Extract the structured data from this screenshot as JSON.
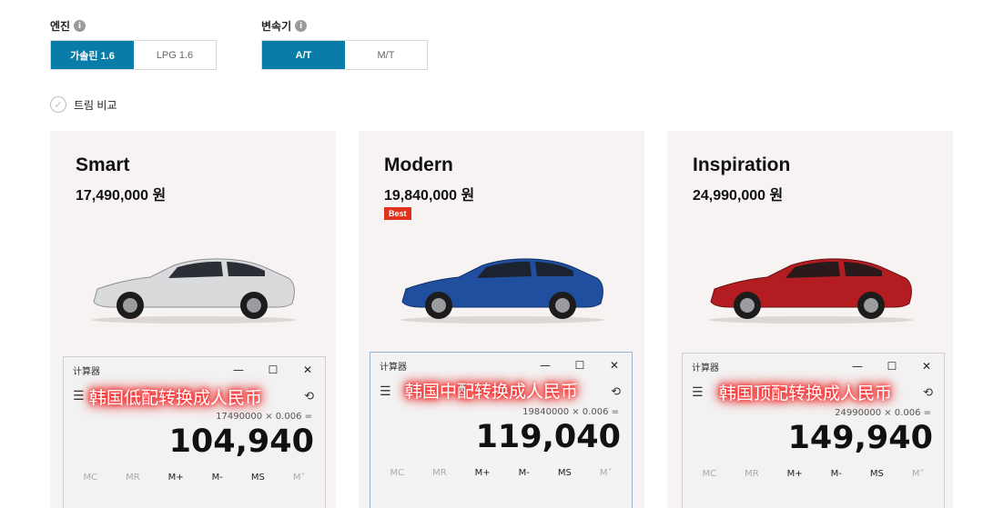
{
  "engine": {
    "label": "엔진",
    "options": [
      {
        "label": "가솔린 1.6",
        "active": true
      },
      {
        "label": "LPG 1.6",
        "active": false
      }
    ]
  },
  "transmission": {
    "label": "변속기",
    "options": [
      {
        "label": "A/T",
        "active": true
      },
      {
        "label": "M/T",
        "active": false
      }
    ]
  },
  "info_icon_glyph": "i",
  "compare": {
    "label": "트림 비교",
    "glyph": "✓"
  },
  "trims": [
    {
      "name": "Smart",
      "price": "17,490,000 원",
      "car_color": "#d9dadc"
    },
    {
      "name": "Modern",
      "price": "19,840,000 원",
      "badge": "Best",
      "car_color": "#1f4f9e"
    },
    {
      "name": "Inspiration",
      "price": "24,990,000 원",
      "car_color": "#b31d22"
    }
  ],
  "calculators": [
    {
      "title": "计算器",
      "overlay": "韩国低配转换成人民币",
      "expression": "17490000 × 0.006 =",
      "result": "104,940"
    },
    {
      "title": "计算器",
      "overlay": "韩国中配转换成人民币",
      "expression": "19840000 × 0.006 =",
      "result": "119,040"
    },
    {
      "title": "计算器",
      "overlay": "韩国顶配转换成人民币",
      "expression": "24990000 × 0.006 =",
      "result": "149,940"
    }
  ],
  "window_controls": {
    "minimize": "—",
    "maximize": "☐",
    "close": "✕"
  },
  "menu_glyph": "☰",
  "history_glyph": "⟲",
  "memory_buttons": [
    "MC",
    "MR",
    "M+",
    "M-",
    "MS",
    "M˅"
  ]
}
